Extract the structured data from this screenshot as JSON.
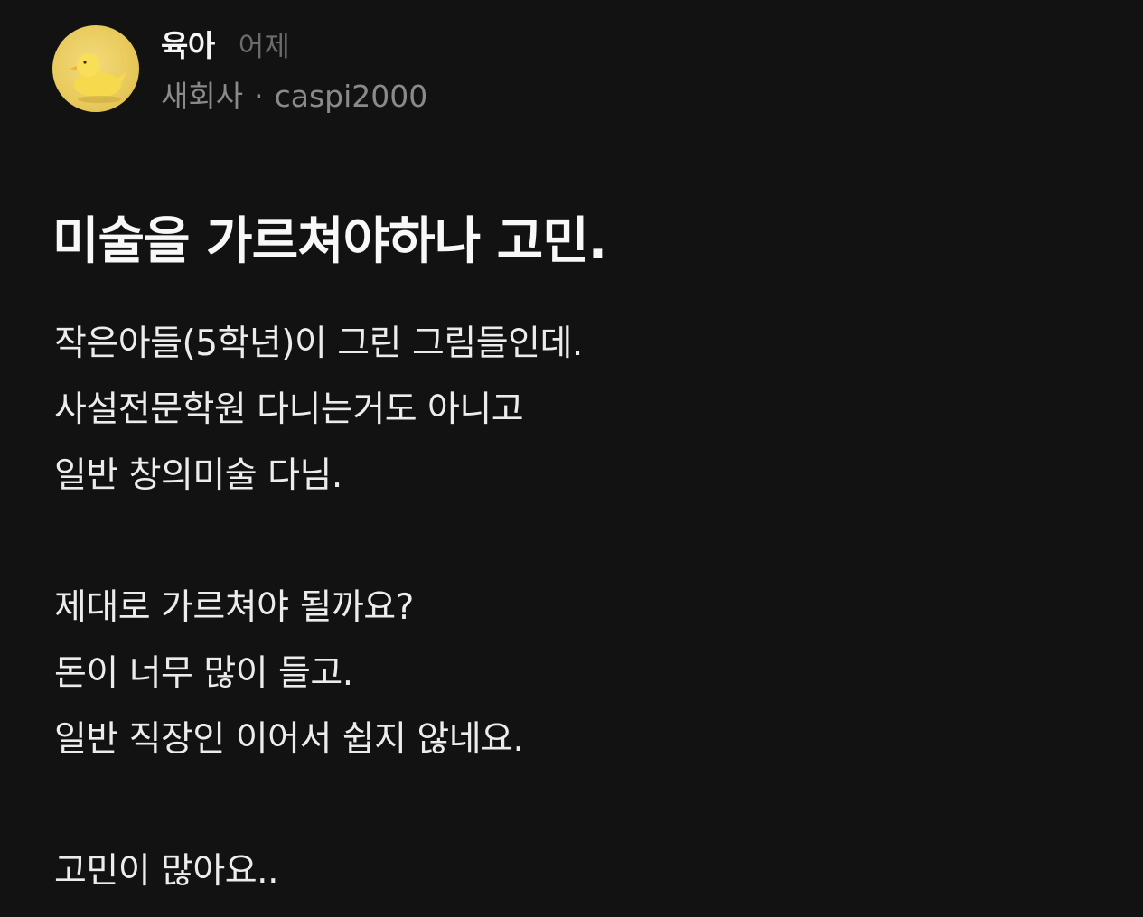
{
  "post": {
    "category": "육아",
    "time": "어제",
    "company": "새회사",
    "separator": "·",
    "username": "caspi2000",
    "avatar_icon": "rubber-duck-icon",
    "title": "미술을 가르쳐야하나 고민.",
    "body_lines": [
      "작은아들(5학년)이 그린 그림들인데.",
      "사설전문학원 다니는거도 아니고",
      "일반 창의미술 다님.",
      "",
      "제대로 가르쳐야 될까요?",
      "돈이 너무 많이 들고.",
      "일반 직장인 이어서 쉽지 않네요.",
      "",
      "고민이 많아요.."
    ]
  },
  "colors": {
    "background": "#121212",
    "title": "#f8f8f8",
    "body": "#ececec",
    "meta": "#8a8a8a",
    "time": "#6b6b6b",
    "avatar_bg": "#e8c95b"
  }
}
